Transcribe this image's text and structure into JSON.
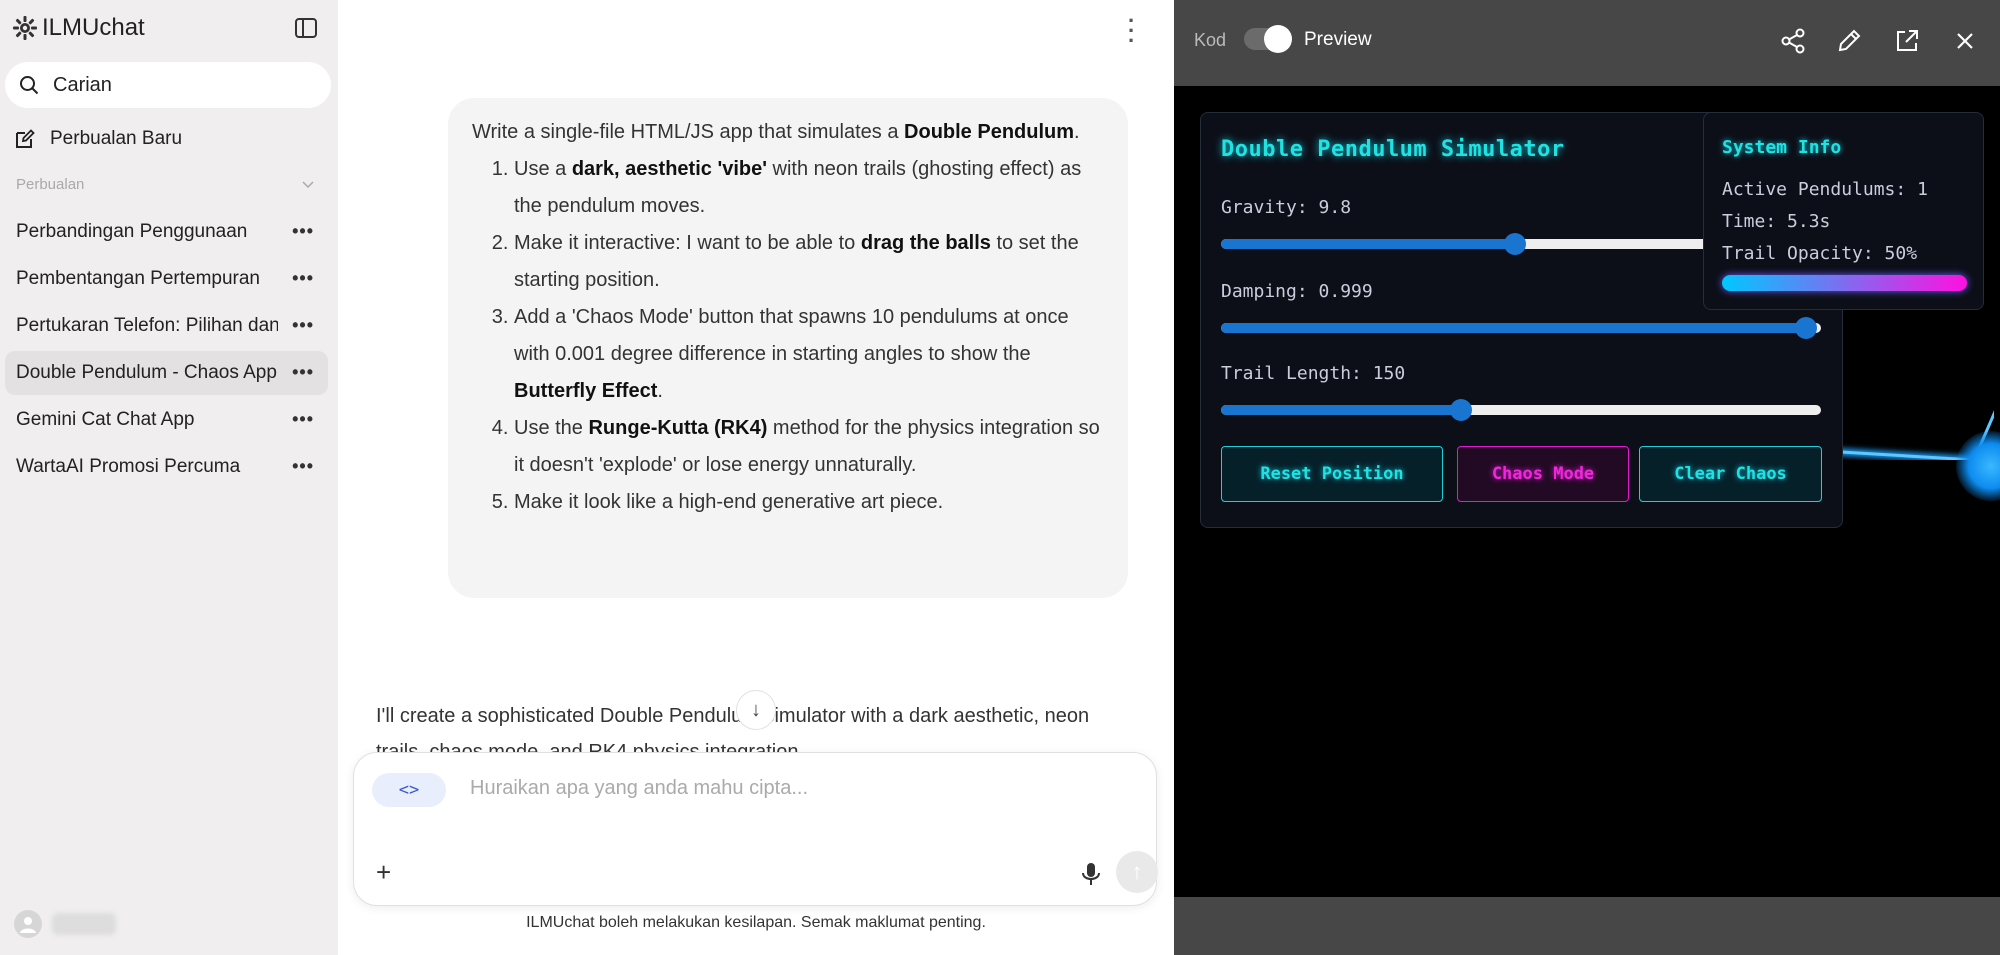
{
  "sidebar": {
    "brand": "ILMUchat",
    "search_label": "Carian",
    "new_chat_label": "Perbualan Baru",
    "section_label": "Perbualan",
    "chats": [
      {
        "label": "Perbandingan Penggunaan"
      },
      {
        "label": "Pembentangan Pertempuran"
      },
      {
        "label": "Pertukaran Telefon: Pilihan dan"
      },
      {
        "label": "Double Pendulum - Chaos App"
      },
      {
        "label": "Gemini Cat Chat App"
      },
      {
        "label": "WartaAI Promosi Percuma"
      }
    ],
    "menu_glyph": "•••"
  },
  "chat": {
    "user_message": {
      "intro_1": "Write a single-file HTML/JS app that simulates a ",
      "intro_bold": "Double Pendulum",
      "intro_2": ".",
      "items": [
        {
          "a": "Use a ",
          "b": "dark, aesthetic 'vibe'",
          "c": " with neon trails (ghosting effect) as the pendulum moves."
        },
        {
          "a": "Make it interactive: I want to be able to ",
          "b": "drag the balls",
          "c": " to set the starting position."
        },
        {
          "a": "Add a 'Chaos Mode' button that spawns 10 pendulums at once with 0.001 degree difference in starting angles to show the ",
          "b": "Butterfly Effect",
          "c": "."
        },
        {
          "a": "Use the ",
          "b": "Runge-Kutta (RK4)",
          "c": " method for the physics integration so it doesn't 'explode' or lose energy unnaturally."
        },
        {
          "a": "Make it look like a high-end generative art piece.",
          "b": "",
          "c": ""
        }
      ]
    },
    "assistant_preview": "I'll create a sophisticated Double Pendulum simulator with a dark aesthetic, neon trails, chaos mode, and RK4 physics integration.",
    "composer": {
      "code_chip": "<>",
      "placeholder": "Huraikan apa yang anda mahu cipta..."
    },
    "disclaimer": "ILMUchat boleh melakukan kesilapan. Semak maklumat penting."
  },
  "preview_panel": {
    "code_label": "Kod",
    "preview_label": "Preview",
    "icons": [
      "share-icon",
      "edit-icon",
      "open-external-icon",
      "close-icon"
    ]
  },
  "simulator": {
    "title": "Double Pendulum Simulator",
    "controls": [
      {
        "label": "Gravity: 9.8",
        "fraction": 0.49
      },
      {
        "label": "Damping: 0.999",
        "fraction": 0.975
      },
      {
        "label": "Trail Length: 150",
        "fraction": 0.4
      }
    ],
    "buttons": {
      "reset": "Reset Position",
      "chaos": "Chaos Mode",
      "clear": "Clear Chaos"
    },
    "system_info": {
      "title": "System Info",
      "active": "Active Pendulums: 1",
      "time": "Time: 5.3s",
      "opacity": "Trail Opacity: 50%"
    },
    "colors": {
      "cyan": "#1fe3e3",
      "magenta": "#f028dc",
      "slider": "#1a75d1"
    }
  }
}
